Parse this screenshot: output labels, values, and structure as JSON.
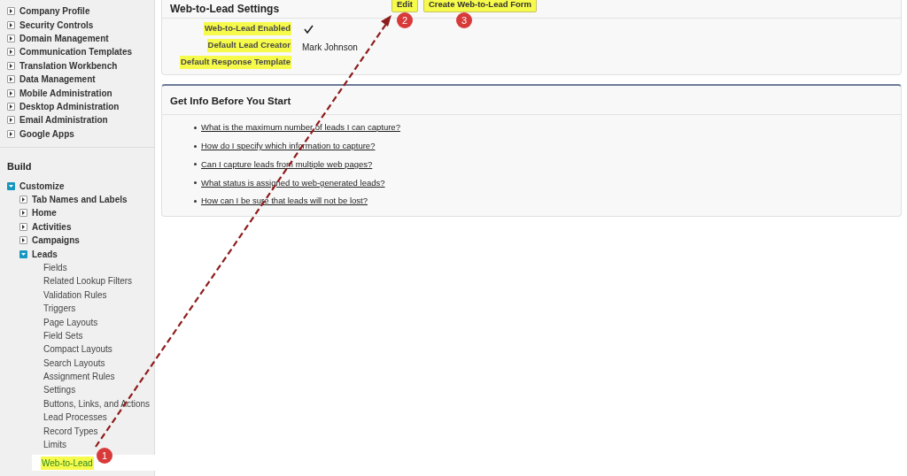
{
  "sidebar": {
    "setup_items": [
      {
        "label": "Company Profile",
        "expanded": false
      },
      {
        "label": "Security Controls",
        "expanded": false
      },
      {
        "label": "Domain Management",
        "expanded": false
      },
      {
        "label": "Communication Templates",
        "expanded": false
      },
      {
        "label": "Translation Workbench",
        "expanded": false
      },
      {
        "label": "Data Management",
        "expanded": false
      },
      {
        "label": "Mobile Administration",
        "expanded": false
      },
      {
        "label": "Desktop Administration",
        "expanded": false
      },
      {
        "label": "Email Administration",
        "expanded": false
      },
      {
        "label": "Google Apps",
        "expanded": false
      }
    ],
    "section_title": "Build",
    "tree": [
      {
        "label": "Customize",
        "expanded": true,
        "children": [
          {
            "label": "Tab Names and Labels",
            "expanded": false
          },
          {
            "label": "Home",
            "expanded": false
          },
          {
            "label": "Activities",
            "expanded": false
          },
          {
            "label": "Campaigns",
            "expanded": false
          },
          {
            "label": "Leads",
            "expanded": true,
            "children": [
              {
                "label": "Fields",
                "selected": false,
                "highlighted": false
              },
              {
                "label": "Related Lookup Filters",
                "selected": false,
                "highlighted": false
              },
              {
                "label": "Validation Rules",
                "selected": false,
                "highlighted": false
              },
              {
                "label": "Triggers",
                "selected": false,
                "highlighted": false
              },
              {
                "label": "Page Layouts",
                "selected": false,
                "highlighted": false
              },
              {
                "label": "Field Sets",
                "selected": false,
                "highlighted": false
              },
              {
                "label": "Compact Layouts",
                "selected": false,
                "highlighted": false
              },
              {
                "label": "Search Layouts",
                "selected": false,
                "highlighted": false
              },
              {
                "label": "Assignment Rules",
                "selected": false,
                "highlighted": false
              },
              {
                "label": "Settings",
                "selected": false,
                "highlighted": false
              },
              {
                "label": "Buttons, Links, and Actions",
                "selected": false,
                "highlighted": false
              },
              {
                "label": "Lead Processes",
                "selected": false,
                "highlighted": false
              },
              {
                "label": "Record Types",
                "selected": false,
                "highlighted": false
              },
              {
                "label": "Limits",
                "selected": false,
                "highlighted": false
              },
              {
                "label": "Web-to-Lead",
                "selected": true,
                "highlighted": true,
                "badge": "1"
              }
            ]
          }
        ]
      }
    ]
  },
  "settings_panel": {
    "title": "Web-to-Lead Settings",
    "buttons": [
      {
        "label": "Edit",
        "highlighted": true,
        "badge": "2"
      },
      {
        "label": "Create Web-to-Lead Form",
        "highlighted": true,
        "badge": "3"
      }
    ],
    "fields": [
      {
        "label": "Web-to-Lead Enabled",
        "highlighted": true,
        "kind": "check",
        "checked": true
      },
      {
        "label": "Default Lead Creator",
        "highlighted": true,
        "kind": "text",
        "value": "Mark Johnson"
      },
      {
        "label": "Default Response Template",
        "highlighted": true,
        "kind": "empty"
      }
    ]
  },
  "info_panel": {
    "title": "Get Info Before You Start",
    "links": [
      "What is the maximum number of leads I can capture?",
      "How do I specify which information to capture?",
      "Can I capture leads from multiple web pages?",
      "What status is assigned to web-generated leads?",
      "How can I be sure that leads will not be lost?"
    ]
  }
}
